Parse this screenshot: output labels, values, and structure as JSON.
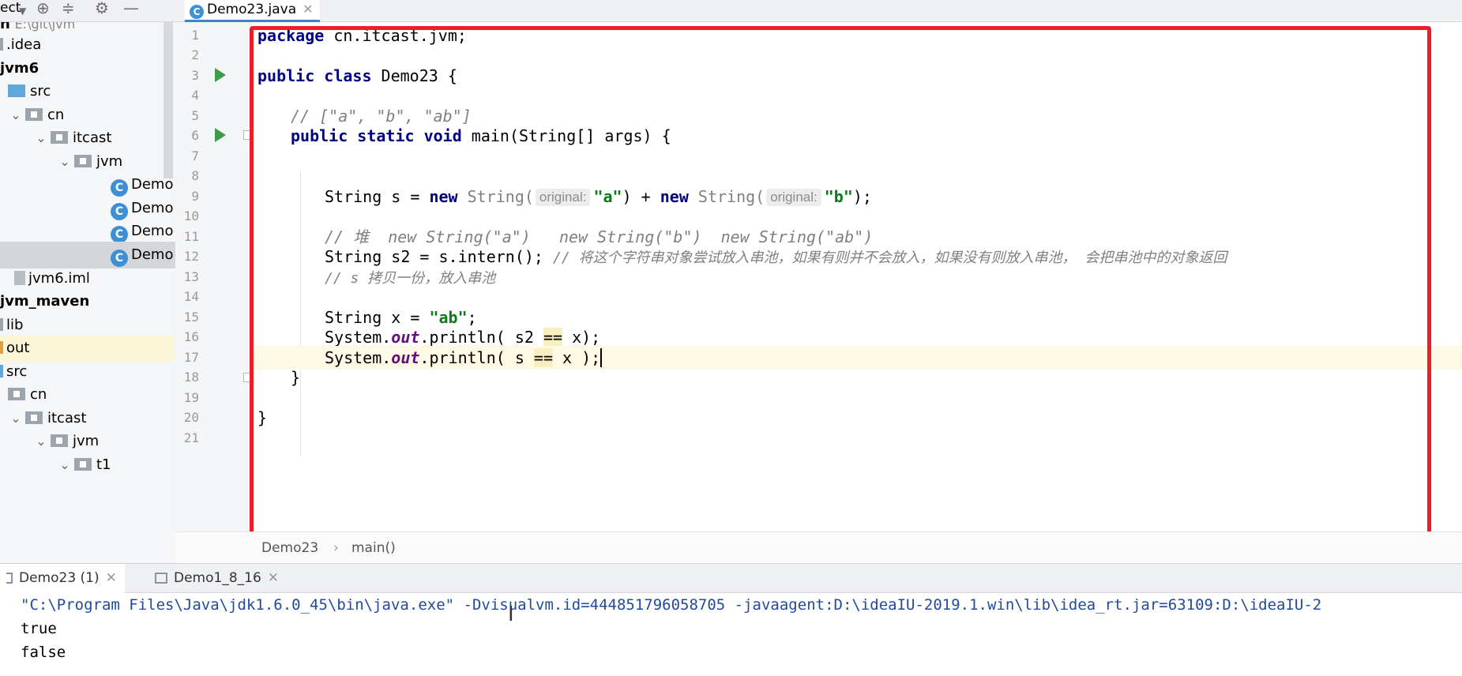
{
  "project_toolbar": {
    "label": "ect",
    "icons": [
      "chevron-down-icon",
      "crosshair-icon",
      "collapse-icon",
      "gear-icon",
      "minimize-icon"
    ]
  },
  "tree": {
    "root_path": "E:\\git\\jvm",
    "items": [
      {
        "label": ".idea"
      },
      {
        "label": "jvm6"
      },
      {
        "label": "src"
      },
      {
        "label": "cn"
      },
      {
        "label": "itcast"
      },
      {
        "label": "jvm"
      },
      {
        "label": "Demo"
      },
      {
        "label": "Demo"
      },
      {
        "label": "Demo"
      },
      {
        "label": "Demo"
      },
      {
        "label": "jvm6.iml"
      },
      {
        "label": "jvm_maven"
      },
      {
        "label": "lib"
      },
      {
        "label": "out"
      },
      {
        "label": "src"
      },
      {
        "label": "cn"
      },
      {
        "label": "itcast"
      },
      {
        "label": "jvm"
      },
      {
        "label": "t1"
      }
    ]
  },
  "editor": {
    "tab_label": "Demo23.java",
    "line_numbers": [
      "1",
      "2",
      "3",
      "4",
      "5",
      "6",
      "7",
      "8",
      "9",
      "10",
      "11",
      "12",
      "13",
      "14",
      "15",
      "16",
      "17",
      "18",
      "19",
      "20",
      "21"
    ],
    "code": {
      "l1_kw": "package",
      "l1_rest": " cn.itcast.jvm;",
      "l3_kw": "public class",
      "l3_rest": " Demo23 {",
      "l5_comment": "// [\"a\", \"b\", \"ab\"]",
      "l6_kw": "public static void",
      "l6_rest": " main(String[] args) {",
      "l9_a": "String s = ",
      "l9_new1": "new",
      "l9_t1": " String(",
      "l9_hint1": "original:",
      "l9_s1": "\"a\"",
      "l9_plus": ") + ",
      "l9_new2": "new",
      "l9_t2": " String(",
      "l9_hint2": "original:",
      "l9_s2": "\"b\"",
      "l9_end": ");",
      "l11_comment": "// 堆  new String(\"a\")   new String(\"b\")  new String(\"ab\")",
      "l12_code": "String s2 = s.intern(); ",
      "l12_comment": "// 将这个字符串对象尝试放入串池，如果有则并不会放入，如果没有则放入串池， 会把串池中的对象返回",
      "l13_comment": "// s 拷贝一份，放入串池",
      "l15_a": "String x = ",
      "l15_s": "\"ab\"",
      "l15_end": ";",
      "l16_a": "System.",
      "l16_out": "out",
      "l16_b": ".println( s2 ",
      "l16_eq": "==",
      "l16_c": " x);",
      "l17_a": "System.",
      "l17_out": "out",
      "l17_b": ".println( s ",
      "l17_eq": "==",
      "l17_c": " x );",
      "l18": "}",
      "l20": "}"
    }
  },
  "breadcrumb": {
    "items": [
      "Demo23",
      "main()"
    ],
    "separator": "›"
  },
  "run_panel": {
    "tabs": [
      {
        "label": "Demo23 (1)"
      },
      {
        "label": "Demo1_8_16"
      }
    ],
    "console": {
      "command": "\"C:\\Program Files\\Java\\jdk1.6.0_45\\bin\\java.exe\" -Dvisualvm.id=444851796058705 -javaagent:D:\\ideaIU-2019.1.win\\lib\\idea_rt.jar=63109:D:\\ideaIU-2",
      "output": [
        "true",
        "false"
      ]
    }
  },
  "colors": {
    "keyword": "#000080",
    "string": "#067d17",
    "comment": "#808080",
    "field": "#660e7a",
    "highlight_box": "#e8202a",
    "run_icon": "#3d9c4a"
  }
}
